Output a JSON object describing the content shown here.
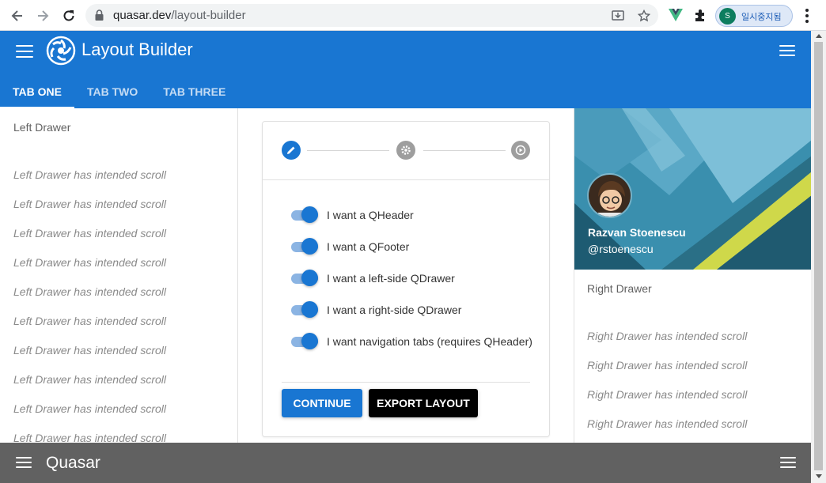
{
  "browser": {
    "url_host": "quasar.dev",
    "url_path": "/layout-builder",
    "profile_initial": "S",
    "profile_label": "일시중지됨"
  },
  "header": {
    "title": "Layout Builder",
    "tabs": [
      {
        "label": "TAB ONE",
        "active": true
      },
      {
        "label": "TAB TWO",
        "active": false
      },
      {
        "label": "TAB THREE",
        "active": false
      }
    ]
  },
  "left_drawer": {
    "title": "Left Drawer",
    "scroll_lines": [
      "Left Drawer has intended scroll",
      "Left Drawer has intended scroll",
      "Left Drawer has intended scroll",
      "Left Drawer has intended scroll",
      "Left Drawer has intended scroll",
      "Left Drawer has intended scroll",
      "Left Drawer has intended scroll",
      "Left Drawer has intended scroll",
      "Left Drawer has intended scroll",
      "Left Drawer has intended scroll"
    ]
  },
  "stepper": {
    "steps": [
      {
        "icon": "pencil-icon",
        "active": true
      },
      {
        "icon": "gear-icon",
        "active": false
      },
      {
        "icon": "play-circle-icon",
        "active": false
      }
    ],
    "options": [
      {
        "label": "I want a QHeader",
        "checked": true
      },
      {
        "label": "I want a QFooter",
        "checked": true
      },
      {
        "label": "I want a left-side QDrawer",
        "checked": true
      },
      {
        "label": "I want a right-side QDrawer",
        "checked": true
      },
      {
        "label": "I want navigation tabs (requires QHeader)",
        "checked": true
      }
    ],
    "continue_label": "CONTINUE",
    "export_label": "EXPORT LAYOUT"
  },
  "right_drawer": {
    "name": "Razvan Stoenescu",
    "handle": "@rstoenescu",
    "title": "Right Drawer",
    "scroll_lines": [
      "Right Drawer has intended scroll",
      "Right Drawer has intended scroll",
      "Right Drawer has intended scroll",
      "Right Drawer has intended scroll"
    ]
  },
  "footer": {
    "title": "Quasar"
  },
  "colors": {
    "primary": "#1976d2",
    "footer": "#616161",
    "export_button": "#000000"
  }
}
